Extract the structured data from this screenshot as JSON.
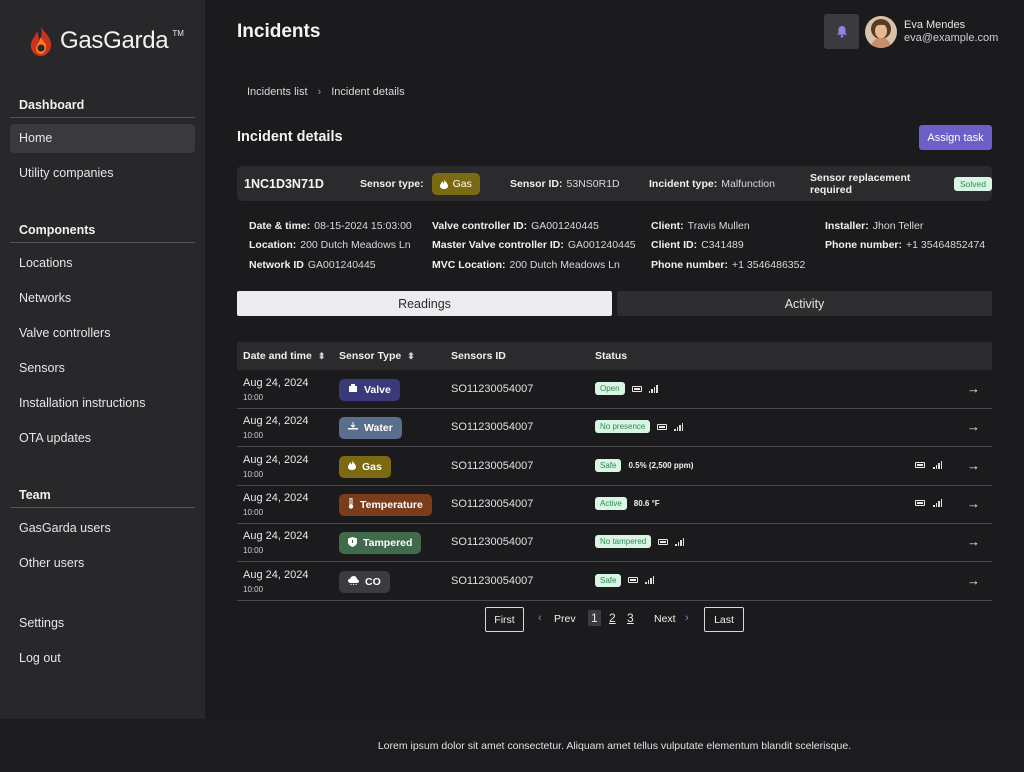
{
  "app": {
    "brand": "GasGarda",
    "trademark": "TM"
  },
  "sidebar": {
    "sections": [
      {
        "heading": "Dashboard",
        "items": [
          "Home",
          "Utility companies"
        ]
      },
      {
        "heading": "Components",
        "items": [
          "Locations",
          "Networks",
          "Valve controllers",
          "Sensors",
          "Installation instructions",
          "OTA updates"
        ]
      },
      {
        "heading": "Team",
        "items": [
          "GasGarda users",
          "Other users"
        ]
      }
    ],
    "bottom_items": [
      "Settings",
      "Log out"
    ],
    "active_item": "Home"
  },
  "header": {
    "title": "Incidents",
    "user_name": "Eva Mendes",
    "user_email": "eva@example.com"
  },
  "breadcrumb": {
    "items": [
      "Incidents list",
      "Incident details"
    ],
    "separator": "›"
  },
  "incident": {
    "section_title": "Incident details",
    "assign_label": "Assign task",
    "id": "1NC1D3N71D",
    "sensor_type_label": "Sensor type:",
    "sensor_type": "Gas",
    "sensor_id_label": "Sensor ID:",
    "sensor_id": "53NS0R1D",
    "incident_type_label": "Incident type:",
    "incident_type": "Malfunction",
    "replacement_label": "Sensor replacement required",
    "replacement_status": "Solved",
    "details": {
      "datetime_label": "Date & time:",
      "datetime": "08-15-2024 15:03:00",
      "location_label": "Location:",
      "location": "200 Dutch Meadows Ln",
      "network_label": "Network ID",
      "network": "GA001240445",
      "valve_label": "Valve controller ID:",
      "valve": "GA001240445",
      "master_valve_label": "Master Valve controller ID:",
      "master_valve": "GA001240445",
      "mvc_location_label": "MVC Location:",
      "mvc_location": "200 Dutch Meadows Ln",
      "client_label": "Client:",
      "client": "Travis Mullen",
      "client_id_label": "Client ID:",
      "client_id": "C341489",
      "phone_label": "Phone number:",
      "phone": "+1 3546486352",
      "installer_label": "Installer:",
      "installer": "Jhon Teller",
      "installer_phone_label": "Phone number:",
      "installer_phone": "+1 35464852474"
    }
  },
  "tabs": [
    "Readings",
    "Activity"
  ],
  "table": {
    "headers": [
      "Date and time",
      "Sensor Type",
      "Sensors ID",
      "Status"
    ],
    "rows": [
      {
        "date": "Aug 24, 2024",
        "time": "10:00",
        "type": "Valve",
        "type_icon": "valve-icon",
        "type_color": "#3a3a7a",
        "sensor_id": "SO11230054007",
        "status": "Open",
        "reading": "",
        "extra": false
      },
      {
        "date": "Aug 24, 2024",
        "time": "10:00",
        "type": "Water",
        "type_icon": "water-icon",
        "type_color": "#5a6f8e",
        "sensor_id": "SO11230054007",
        "status": "No presence",
        "reading": "",
        "extra": false
      },
      {
        "date": "Aug 24, 2024",
        "time": "10:00",
        "type": "Gas",
        "type_icon": "flame-icon",
        "type_color": "#7b6a12",
        "sensor_id": "SO11230054007",
        "status": "Safe",
        "reading": "0.5% (2,500 ppm)",
        "extra": true
      },
      {
        "date": "Aug 24, 2024",
        "time": "10:00",
        "type": "Temperature",
        "type_icon": "thermometer-icon",
        "type_color": "#7a3d1c",
        "sensor_id": "SO11230054007",
        "status": "Active",
        "reading": "80.6 °F",
        "extra": true
      },
      {
        "date": "Aug 24, 2024",
        "time": "10:00",
        "type": "Tampered",
        "type_icon": "shield-icon",
        "type_color": "#3f6b4c",
        "sensor_id": "SO11230054007",
        "status": "No tampered",
        "reading": "",
        "extra": false
      },
      {
        "date": "Aug 24, 2024",
        "time": "10:00",
        "type": "CO",
        "type_icon": "cloud-icon",
        "type_color": "#3c3c40",
        "sensor_id": "SO11230054007",
        "status": "Safe",
        "reading": "",
        "extra": false
      }
    ]
  },
  "pagination": {
    "first": "First",
    "prev": "Prev",
    "pages": [
      "1",
      "2",
      "3"
    ],
    "current": "1",
    "next": "Next",
    "last": "Last"
  },
  "footer": {
    "text": "Lorem ipsum dolor sit amet consectetur. Aliquam amet tellus vulputate elementum blandit scelerisque."
  },
  "colors": {
    "accent": "#6c5fc7",
    "badge_bg": "#d9f5e3",
    "badge_text": "#2d8a55"
  }
}
